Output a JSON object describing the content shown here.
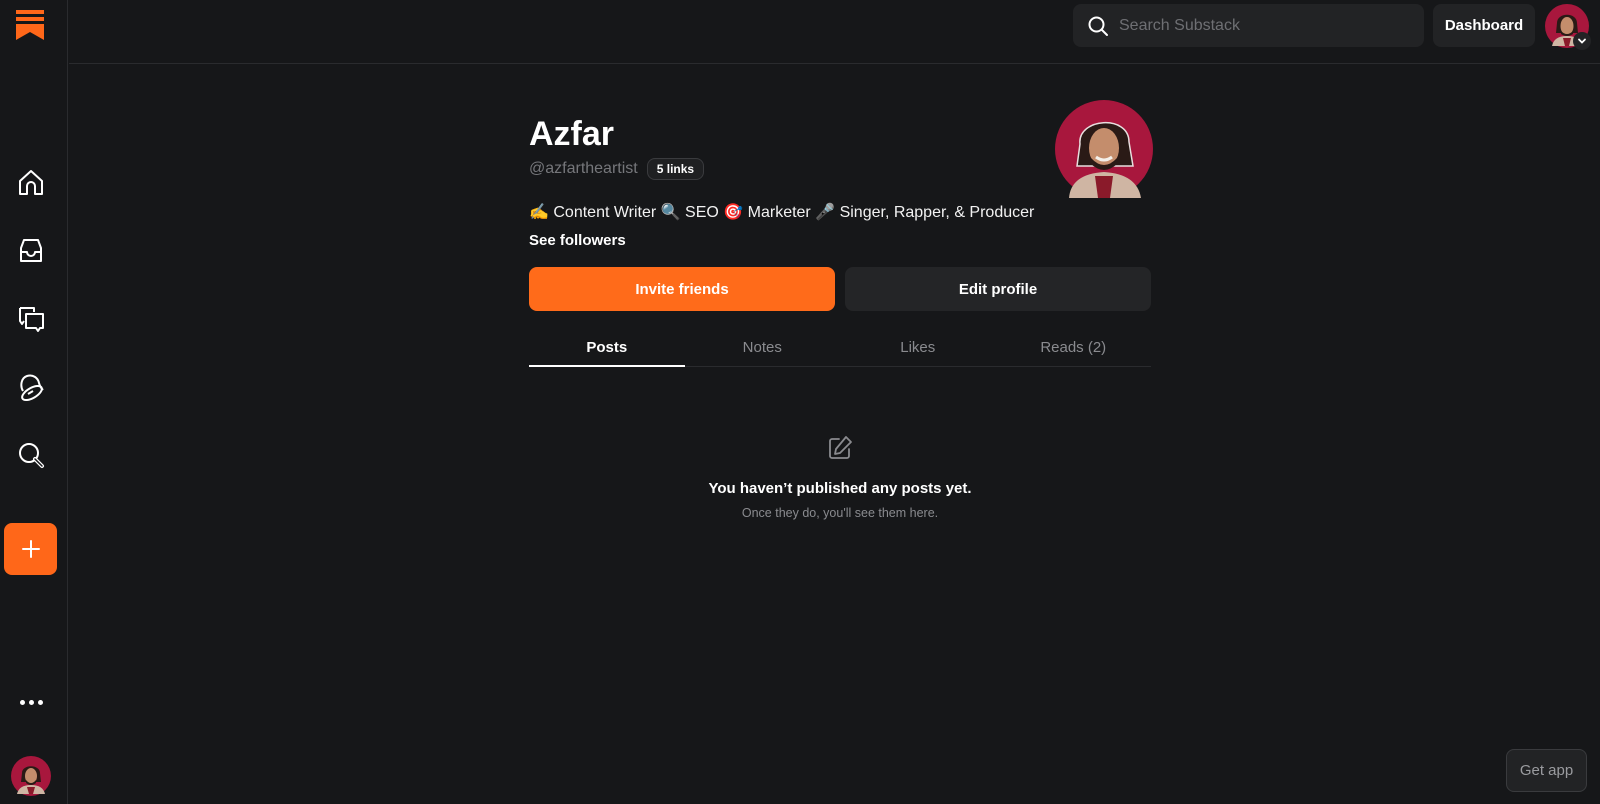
{
  "app": {
    "name": "Substack",
    "brand_color": "#ff6719"
  },
  "sidebar": {
    "items": [
      {
        "name": "home",
        "icon": "home-icon"
      },
      {
        "name": "inbox",
        "icon": "inbox-icon"
      },
      {
        "name": "chat",
        "icon": "chat-icon"
      },
      {
        "name": "activity",
        "icon": "bell-icon"
      },
      {
        "name": "search",
        "icon": "search-icon"
      }
    ],
    "compose_icon": "plus-icon",
    "more_icon": "more-dots-icon"
  },
  "header": {
    "search_placeholder": "Search Substack",
    "search_value": "",
    "dashboard_label": "Dashboard"
  },
  "profile": {
    "name": "Azfar",
    "handle": "@azfartheartist",
    "links_badge": "5 links",
    "bio": "✍️ Content Writer 🔍 SEO 🎯 Marketer 🎤 Singer, Rapper, & Producer",
    "see_followers": "See followers",
    "invite_label": "Invite friends",
    "edit_label": "Edit profile"
  },
  "tabs": [
    {
      "label": "Posts",
      "active": true
    },
    {
      "label": "Notes",
      "active": false
    },
    {
      "label": "Likes",
      "active": false
    },
    {
      "label": "Reads (2)",
      "active": false
    }
  ],
  "empty_state": {
    "title": "You haven’t published any posts yet.",
    "subtitle": "Once they do, you'll see them here."
  },
  "get_app_label": "Get app"
}
